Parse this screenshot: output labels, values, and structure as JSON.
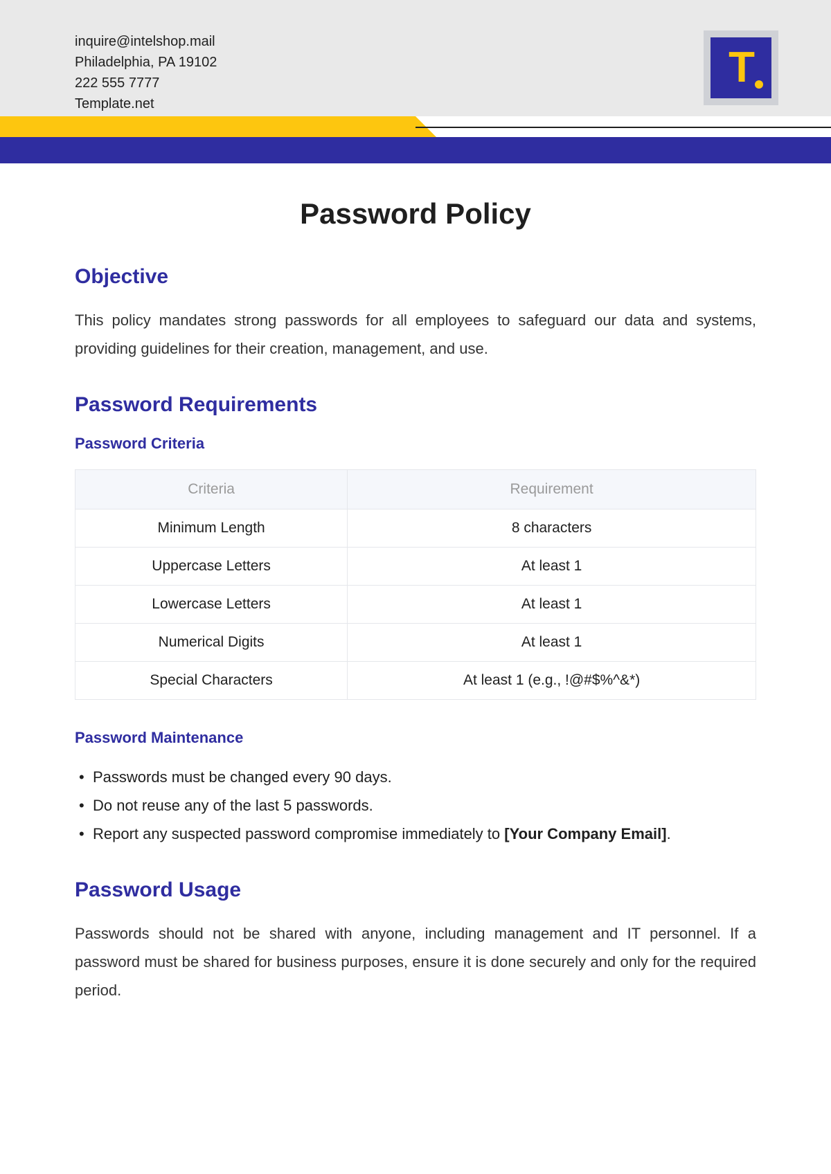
{
  "header": {
    "email": "inquire@intelshop.mail",
    "address": "Philadelphia, PA 19102",
    "phone": "222 555 7777",
    "site": "Template.net",
    "logo_letter": "T"
  },
  "colors": {
    "accent_blue": "#2f2da0",
    "accent_yellow": "#fdc60f",
    "header_bg": "#e9e9e9"
  },
  "document": {
    "title": "Password Policy",
    "objective_heading": "Objective",
    "objective_text": "This policy mandates strong passwords for all employees to safeguard our data and systems, providing guidelines for their creation, management, and use.",
    "requirements_heading": "Password Requirements",
    "criteria_heading": "Password Criteria",
    "table": {
      "cols": [
        "Criteria",
        "Requirement"
      ],
      "rows": [
        [
          "Minimum Length",
          "8 characters"
        ],
        [
          "Uppercase Letters",
          "At least 1"
        ],
        [
          "Lowercase Letters",
          "At least 1"
        ],
        [
          "Numerical Digits",
          "At least 1"
        ],
        [
          "Special Characters",
          "At least 1 (e.g., !@#$%^&*)"
        ]
      ]
    },
    "maintenance_heading": "Password Maintenance",
    "maintenance_items": [
      {
        "text": "Passwords must be changed every 90 days.",
        "bold": ""
      },
      {
        "text": "Do not reuse any of the last 5 passwords.",
        "bold": ""
      },
      {
        "text": "Report any suspected password compromise immediately to ",
        "bold": "[Your Company Email]"
      }
    ],
    "usage_heading": "Password Usage",
    "usage_text": "Passwords should not be shared with anyone, including management and IT personnel. If a password must be shared for business purposes, ensure it is done securely and only for the required period."
  }
}
